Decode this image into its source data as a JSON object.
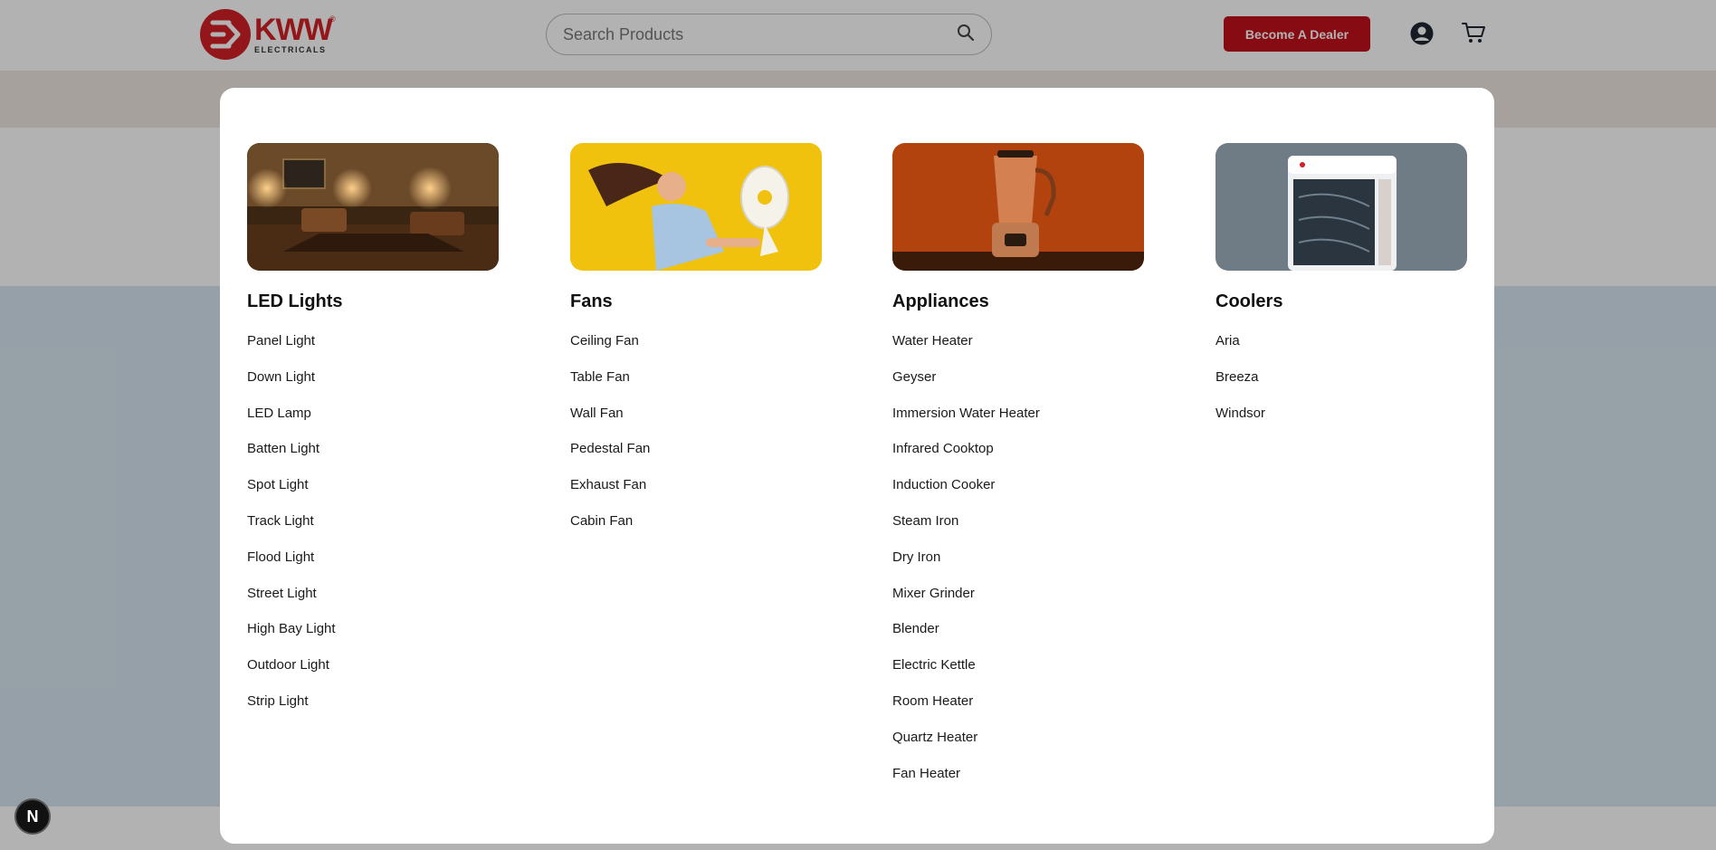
{
  "header": {
    "logo": {
      "brand": "KWW",
      "sub": "ELECTRICALS",
      "reg": "®"
    },
    "search": {
      "placeholder": "Search Products"
    },
    "dealer_button": "Become A Dealer",
    "icons": [
      "search-icon",
      "user-icon",
      "cart-icon"
    ]
  },
  "badge": "N",
  "colors": {
    "brand_red": "#c0111a",
    "logo_red": "#d32027"
  },
  "menu": {
    "columns": [
      {
        "title": "LED Lights",
        "image": "living-room-lamps",
        "items": [
          "Panel Light",
          "Down Light",
          "LED Lamp",
          "Batten Light",
          "Spot Light",
          "Track Light",
          "Flood Light",
          "Street Light",
          "High Bay Light",
          "Outdoor Light",
          "Strip Light"
        ]
      },
      {
        "title": "Fans",
        "image": "woman-with-table-fan",
        "items": [
          "Ceiling Fan",
          "Table Fan",
          "Wall Fan",
          "Pedestal Fan",
          "Exhaust Fan",
          "Cabin Fan"
        ]
      },
      {
        "title": "Appliances",
        "image": "blender",
        "items": [
          "Water Heater",
          "Geyser",
          "Immersion Water Heater",
          "Infrared Cooktop",
          "Induction Cooker",
          "Steam Iron",
          "Dry Iron",
          "Mixer Grinder",
          "Blender",
          "Electric Kettle",
          "Room Heater",
          "Quartz Heater",
          "Fan Heater"
        ]
      },
      {
        "title": "Coolers",
        "image": "air-cooler",
        "items": [
          "Aria",
          "Breeza",
          "Windsor"
        ]
      }
    ]
  }
}
